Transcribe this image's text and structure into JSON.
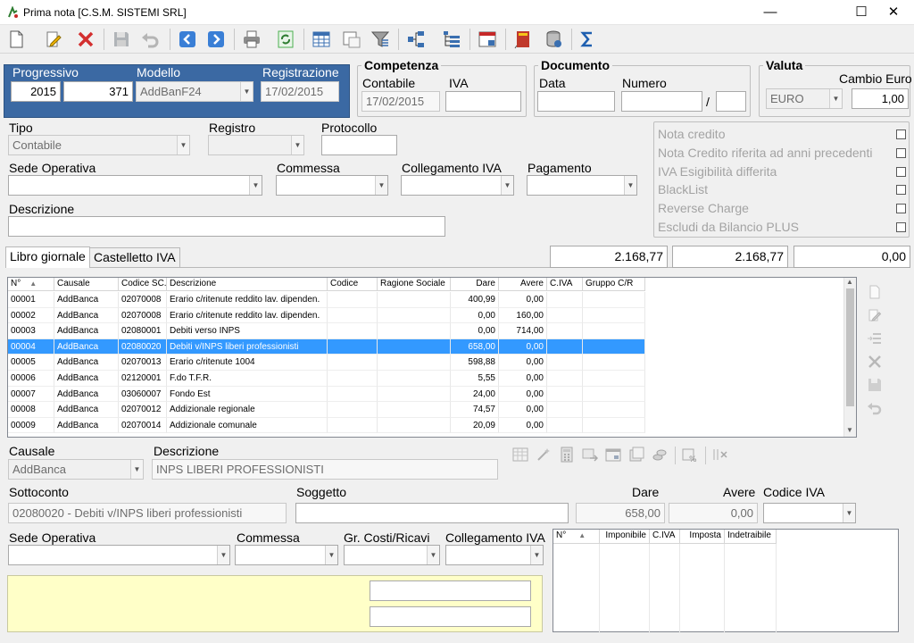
{
  "window": {
    "title": "Prima nota [C.S.M. SISTEMI SRL]"
  },
  "toolbar": {
    "icons": [
      "new-document-icon",
      "edit-icon",
      "delete-icon",
      "save-icon",
      "undo-icon",
      "previous-icon",
      "next-icon",
      "print-icon",
      "refresh-icon",
      "table-icon",
      "window-icon",
      "filter-icon",
      "tree-icon",
      "list-tree-icon",
      "calendar-icon",
      "book-icon",
      "database-icon",
      "sum-icon"
    ]
  },
  "header": {
    "progressivo_label": "Progressivo",
    "modello_label": "Modello",
    "registrazione_label": "Registrazione",
    "anno": "2015",
    "numero": "371",
    "modello": "AddBanF24",
    "registrazione": "17/02/2015"
  },
  "competenza": {
    "title": "Competenza",
    "contabile_label": "Contabile",
    "iva_label": "IVA",
    "contabile": "17/02/2015",
    "iva": ""
  },
  "documento": {
    "title": "Documento",
    "data_label": "Data",
    "numero_label": "Numero",
    "separator": "/"
  },
  "valuta": {
    "title": "Valuta",
    "cambio_label": "Cambio Euro",
    "valuta": "EURO",
    "cambio": "1,00"
  },
  "tipo": {
    "label": "Tipo",
    "value": "Contabile"
  },
  "registro": {
    "label": "Registro"
  },
  "protocollo": {
    "label": "Protocollo"
  },
  "sede": {
    "label": "Sede Operativa"
  },
  "commessa": {
    "label": "Commessa"
  },
  "collegamento": {
    "label": "Collegamento IVA"
  },
  "pagamento": {
    "label": "Pagamento"
  },
  "descrizione": {
    "label": "Descrizione"
  },
  "flags": [
    "Nota credito",
    "Nota Credito riferita ad anni precedenti",
    "IVA Esigibilità differita",
    "BlackList",
    "Reverse Charge",
    "Escludi da Bilancio PLUS"
  ],
  "tabs": {
    "libro": "Libro giornale",
    "castelletto": "Castelletto IVA"
  },
  "totals": {
    "dare": "2.168,77",
    "avere": "2.168,77",
    "saldo": "0,00"
  },
  "grid": {
    "headers": [
      "N°",
      "Causale",
      "Codice SC.",
      "Descrizione",
      "Codice",
      "Ragione Sociale",
      "Dare",
      "Avere",
      "C.IVA",
      "Gruppo C/R"
    ],
    "rows": [
      [
        "00001",
        "AddBanca",
        "02070008",
        "Erario c/ritenute reddito lav. dipenden.",
        "",
        "",
        "400,99",
        "0,00",
        "",
        ""
      ],
      [
        "00002",
        "AddBanca",
        "02070008",
        "Erario c/ritenute reddito lav. dipenden.",
        "",
        "",
        "0,00",
        "160,00",
        "",
        ""
      ],
      [
        "00003",
        "AddBanca",
        "02080001",
        "Debiti verso INPS",
        "",
        "",
        "0,00",
        "714,00",
        "",
        ""
      ],
      [
        "00004",
        "AddBanca",
        "02080020",
        "Debiti v/INPS liberi professionisti",
        "",
        "",
        "658,00",
        "0,00",
        "",
        ""
      ],
      [
        "00005",
        "AddBanca",
        "02070013",
        "Erario c/ritenute 1004",
        "",
        "",
        "598,88",
        "0,00",
        "",
        ""
      ],
      [
        "00006",
        "AddBanca",
        "02120001",
        "F.do T.F.R.",
        "",
        "",
        "5,55",
        "0,00",
        "",
        ""
      ],
      [
        "00007",
        "AddBanca",
        "03060007",
        "Fondo Est",
        "",
        "",
        "24,00",
        "0,00",
        "",
        ""
      ],
      [
        "00008",
        "AddBanca",
        "02070012",
        "Addizionale regionale",
        "",
        "",
        "74,57",
        "0,00",
        "",
        ""
      ],
      [
        "00009",
        "AddBanca",
        "02070014",
        "Addizionale comunale",
        "",
        "",
        "20,09",
        "0,00",
        "",
        ""
      ]
    ],
    "selected_row": 3
  },
  "detail": {
    "causale_label": "Causale",
    "causale": "AddBanca",
    "descrizione_label": "Descrizione",
    "descrizione": "INPS LIBERI PROFESSIONISTI",
    "sottoconto_label": "Sottoconto",
    "sottoconto": "02080020 - Debiti v/INPS liberi professionisti",
    "soggetto_label": "Soggetto",
    "dare_label": "Dare",
    "avere_label": "Avere",
    "codice_iva_label": "Codice IVA",
    "dare": "658,00",
    "avere": "0,00",
    "sede_label": "Sede Operativa",
    "commessa_label": "Commessa",
    "gruppo_label": "Gr. Costi/Ricavi",
    "collegamento_label": "Collegamento IVA"
  },
  "iva_grid": {
    "headers": [
      "N°",
      "Imponibile",
      "C.IVA",
      "Imposta",
      "Indetraibile"
    ]
  }
}
